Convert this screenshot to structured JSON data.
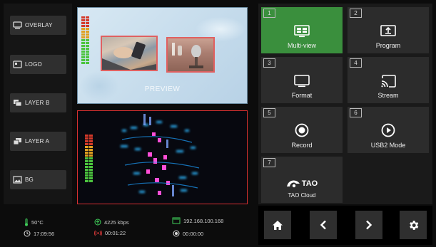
{
  "layers": [
    {
      "label": "OVERLAY",
      "icon": "monitor-icon"
    },
    {
      "label": "LOGO",
      "icon": "logo-icon"
    },
    {
      "label": "LAYER B",
      "icon": "layer-b-icon"
    },
    {
      "label": "LAYER A",
      "icon": "layer-a-icon"
    },
    {
      "label": "BG",
      "icon": "image-icon"
    }
  ],
  "preview": {
    "label": "PREVIEW"
  },
  "status": {
    "temperature": "50°C",
    "clock": "17:09:56",
    "bitrate": "4225 kbps",
    "stream_time": "00:01:22",
    "ip": "192.168.100.168",
    "record_time": "00:00:00"
  },
  "tiles": [
    {
      "num": "1",
      "label": "Multi-view",
      "icon": "multiview-icon",
      "active": true
    },
    {
      "num": "2",
      "label": "Program",
      "icon": "program-icon",
      "active": false
    },
    {
      "num": "3",
      "label": "Format",
      "icon": "format-icon",
      "active": false
    },
    {
      "num": "4",
      "label": "Stream",
      "icon": "cast-icon",
      "active": false
    },
    {
      "num": "5",
      "label": "Record",
      "icon": "record-icon",
      "active": false
    },
    {
      "num": "6",
      "label": "USB2 Mode",
      "icon": "play-icon",
      "active": false
    },
    {
      "num": "7",
      "label": "TAO Cloud",
      "icon": "tao-logo-icon",
      "active": false,
      "logo_text": "TAO"
    }
  ],
  "nav": [
    "home-icon",
    "chevron-left-icon",
    "chevron-right-icon",
    "gear-icon"
  ],
  "colors": {
    "active_tile": "#3a8f3d",
    "tile": "#2c2c2c",
    "program_border": "#d83030",
    "preview_frame": "#e06060"
  }
}
